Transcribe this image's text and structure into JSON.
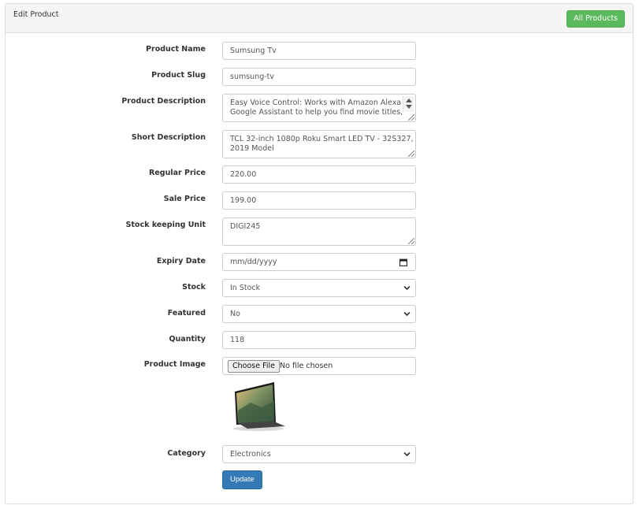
{
  "header": {
    "title": "Edit Product",
    "all_products_label": "All Products"
  },
  "form": {
    "product_name": {
      "label": "Product Name",
      "value": "Sumsung Tv"
    },
    "product_slug": {
      "label": "Product Slug",
      "value": "sumsung-tv"
    },
    "product_description": {
      "label": "Product Description",
      "line1": "Easy Voice Control: Works with Amazon Alexa or",
      "line2": "Google Assistant to help you find movie titles,"
    },
    "short_description": {
      "label": "Short Description",
      "line1": "TCL 32-inch 1080p Roku Smart LED TV - 32S327,",
      "line2": "2019 Model"
    },
    "regular_price": {
      "label": "Regular Price",
      "value": "220.00"
    },
    "sale_price": {
      "label": "Sale Price",
      "value": "199.00"
    },
    "sku": {
      "label": "Stock keeping Unit",
      "value": "DIGI245"
    },
    "expiry_date": {
      "label": "Expiry Date",
      "placeholder": "mm/dd/yyyy"
    },
    "stock": {
      "label": "Stock",
      "selected": "In Stock"
    },
    "featured": {
      "label": "Featured",
      "selected": "No"
    },
    "quantity": {
      "label": "Quantity",
      "value": "118"
    },
    "product_image": {
      "label": "Product Image",
      "button": "Choose File",
      "status": "No file chosen"
    },
    "category": {
      "label": "Category",
      "selected": "Electronics"
    },
    "submit_label": "Update"
  },
  "icons": {
    "select": "chevron-down-icon",
    "date": "calendar-icon",
    "spinner": "spinner-icon",
    "resize": "resize-handle-icon"
  },
  "colors": {
    "success": "#5cb85c",
    "primary": "#337ab7",
    "border": "#cccccc"
  }
}
